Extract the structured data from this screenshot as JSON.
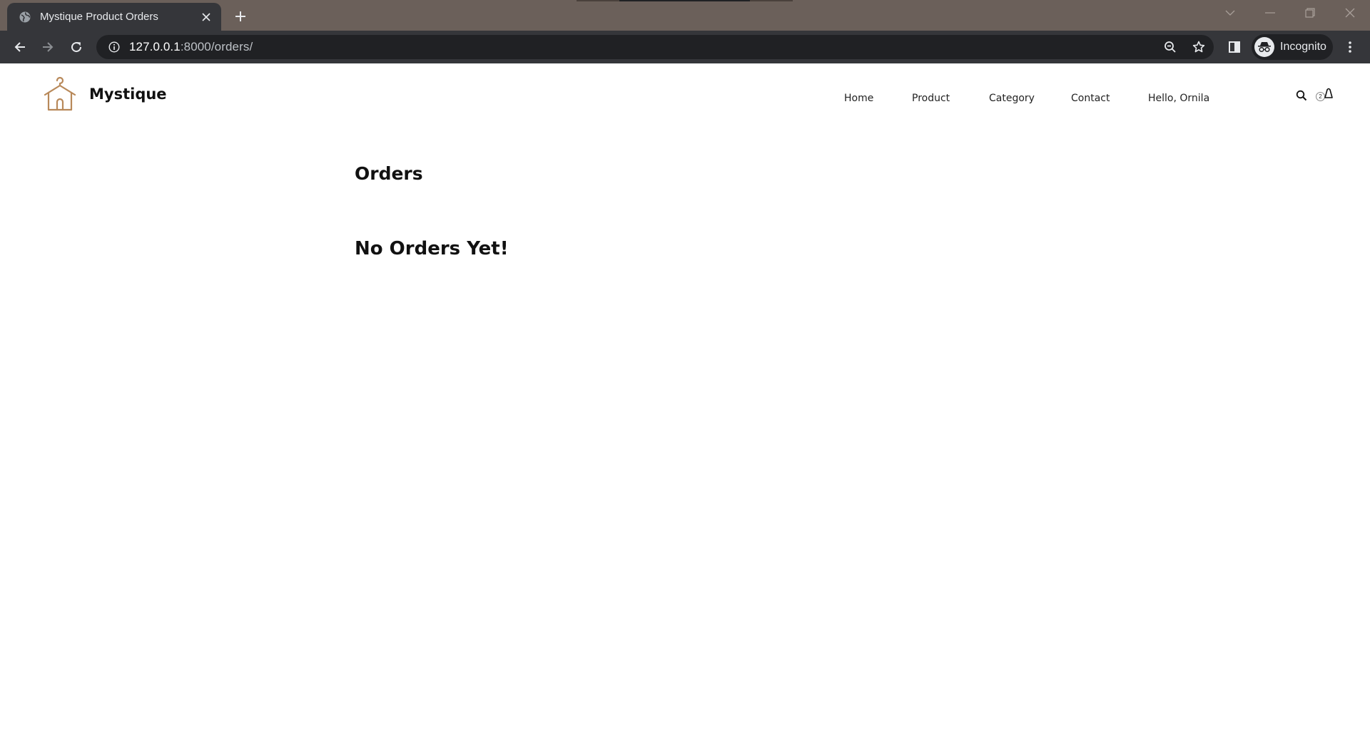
{
  "browser": {
    "tab_title": "Mystique Product Orders",
    "url_host": "127.0.0.1",
    "url_rest": ":8000/orders/",
    "profile_label": "Incognito",
    "icons": {
      "favicon": "globe-icon",
      "close": "close-icon",
      "new_tab": "plus-icon",
      "back": "back-arrow-icon",
      "forward": "forward-arrow-icon",
      "reload": "reload-icon",
      "site_info": "info-icon",
      "zoom": "zoom-out-icon",
      "bookmark": "star-icon",
      "side_panel": "side-panel-icon",
      "incognito": "incognito-icon",
      "menu": "kebab-menu-icon"
    }
  },
  "site": {
    "brand_name": "Mystique",
    "accent_color": "#b8895a",
    "nav": [
      {
        "label": "Home"
      },
      {
        "label": "Product"
      },
      {
        "label": "Category"
      },
      {
        "label": "Contact"
      },
      {
        "label": "Hello, Ornila"
      }
    ],
    "cart_count": "2"
  },
  "main": {
    "title": "Orders",
    "empty_message": "No Orders Yet!"
  }
}
